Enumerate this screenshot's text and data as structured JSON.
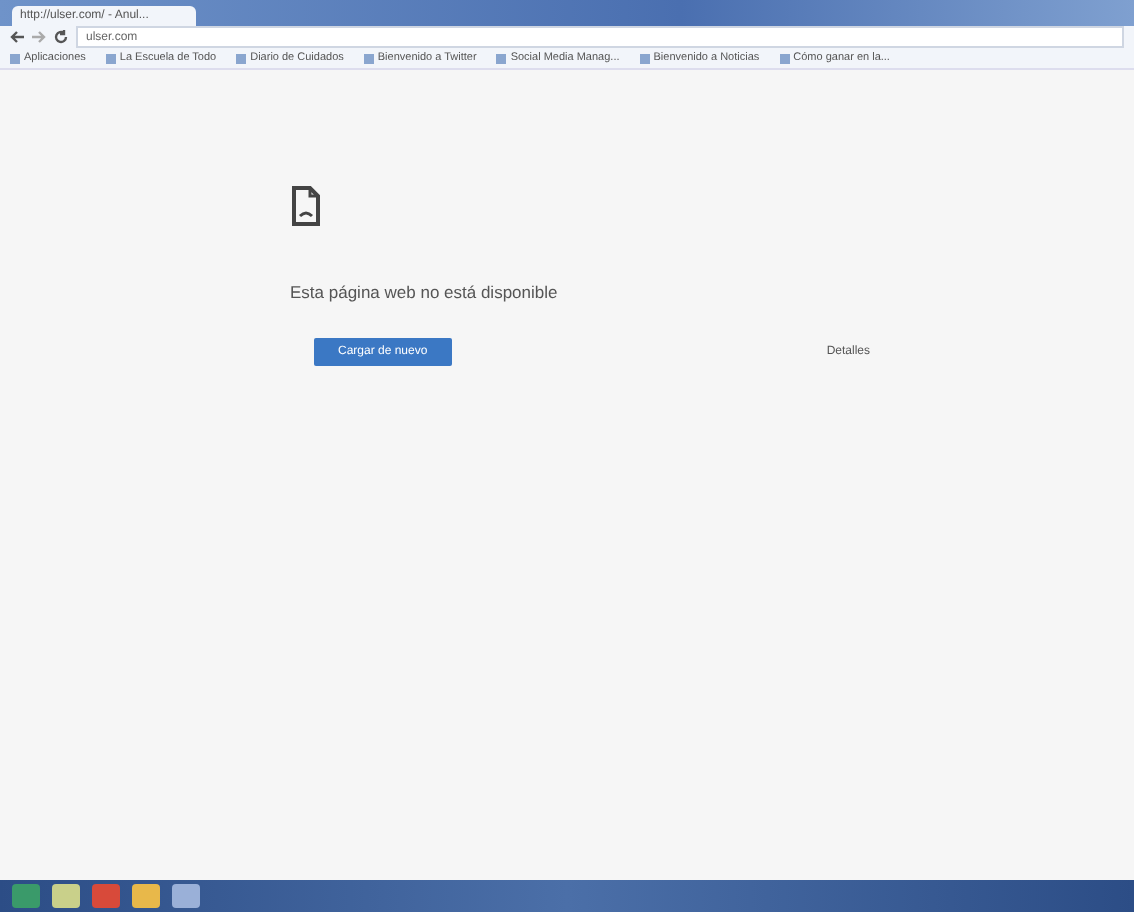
{
  "tab": {
    "title": "http://ulser.com/ - Anul..."
  },
  "address_bar": {
    "value": "ulser.com"
  },
  "bookmarks": [
    {
      "label": "Aplicaciones"
    },
    {
      "label": "La Escuela de Todo"
    },
    {
      "label": "Diario de Cuidados"
    },
    {
      "label": "Bienvenido a Twitter"
    },
    {
      "label": "Social Media Manag..."
    },
    {
      "label": "Bienvenido a Noticias"
    },
    {
      "label": "Cómo ganar en la..."
    }
  ],
  "error_page": {
    "message": "Esta página web no está disponible",
    "reload_button": "Cargar de nuevo",
    "details_link": "Detalles"
  }
}
